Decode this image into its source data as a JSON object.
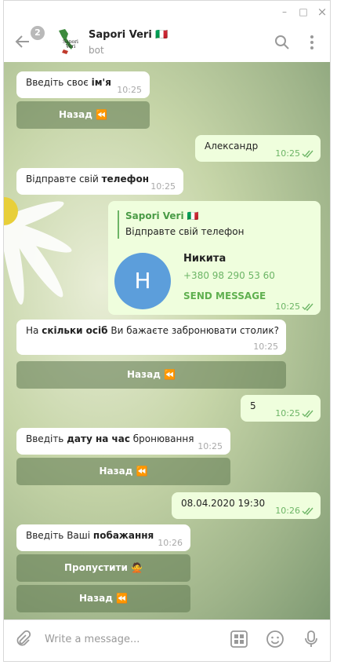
{
  "window": {
    "minimize": "–",
    "maximize": "□",
    "close": "×"
  },
  "header": {
    "unread_count": "2",
    "title": "Sapori Veri 🇮🇹",
    "subtitle": "bot"
  },
  "messages": {
    "m1": {
      "pre": "Введіть своє ",
      "b": "ім'я",
      "time": "10:25"
    },
    "k1": {
      "label": "Назад ⏪"
    },
    "m2": {
      "text": "Александр",
      "time": "10:25"
    },
    "m3": {
      "pre": "Відправте свій ",
      "b": "телефон",
      "time": "10:25"
    },
    "contact": {
      "fwd_from": "Sapori Veri 🇮🇹",
      "fwd_text": "Відправте свій телефон",
      "avatar_letter": "H",
      "name": "Никита",
      "phone": "+380 98 290 53 60",
      "action": "SEND MESSAGE",
      "time": "10:25"
    },
    "m4": {
      "pre": "На ",
      "b": "скільки осіб",
      "post": " Ви бажаєте забронювати столик?",
      "time": "10:25"
    },
    "k2": {
      "label": "Назад ⏪"
    },
    "m5": {
      "text": "5",
      "time": "10:25"
    },
    "m6": {
      "pre": "Введіть ",
      "b": "дату на час",
      "post": " бронювання",
      "time": "10:25"
    },
    "k3": {
      "label": "Назад ⏪"
    },
    "m7": {
      "text": "08.04.2020 19:30",
      "time": "10:26"
    },
    "m8": {
      "pre": "Введіть Ваші ",
      "b": "побажання",
      "time": "10:26"
    },
    "k4": {
      "label": "Пропустити 🙅"
    },
    "k5": {
      "label": "Назад ⏪"
    }
  },
  "composer": {
    "placeholder": "Write a message..."
  }
}
